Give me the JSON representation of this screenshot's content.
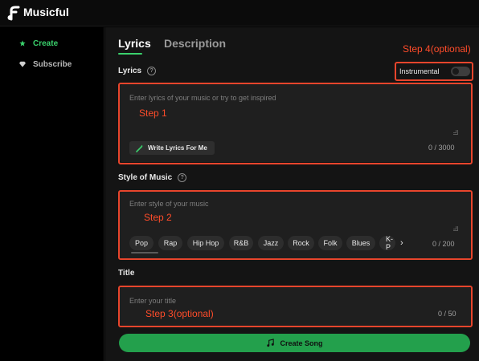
{
  "app": {
    "title": "Musicful",
    "accent": "#3ad16c"
  },
  "sidebar": {
    "items": [
      {
        "label": "Create",
        "icon": "star-icon",
        "active": true
      },
      {
        "label": "Subscribe",
        "icon": "diamond-icon",
        "active": false
      }
    ]
  },
  "tabs": [
    {
      "label": "Lyrics",
      "active": true
    },
    {
      "label": "Description",
      "active": false
    }
  ],
  "lyrics": {
    "label": "Lyrics",
    "help": "?",
    "placeholder": "Enter lyrics of your music or try to get inspired",
    "write_button": "Write Lyrics For Me",
    "counter": "0 / 3000"
  },
  "instrumental": {
    "label": "Instrumental",
    "on": false
  },
  "style": {
    "label": "Style of Music",
    "help": "?",
    "placeholder": "Enter style of your music",
    "chips": [
      "Pop",
      "Rap",
      "Hip Hop",
      "R&B",
      "Jazz",
      "Rock",
      "Folk",
      "Blues",
      "K-P"
    ],
    "counter": "0 / 200"
  },
  "title_field": {
    "label": "Title",
    "placeholder": "Enter your title",
    "counter": "0 / 50"
  },
  "create_button": "Create Song",
  "annotations": {
    "step1": "Step 1",
    "step2": "Step 2",
    "step3": "Step 3(optional)",
    "step4": "Step 4(optional)"
  }
}
